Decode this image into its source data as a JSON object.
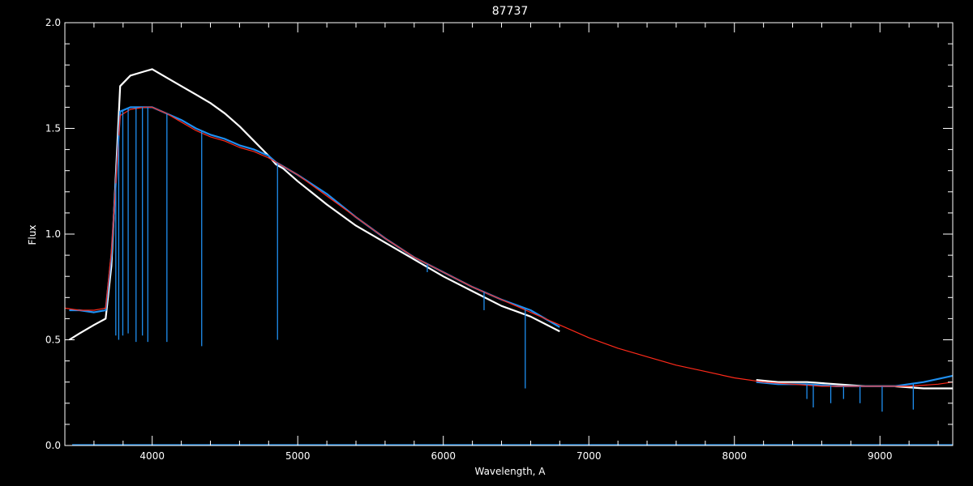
{
  "chart_data": {
    "type": "line",
    "title": "87737",
    "xlabel": "Wavelength, A",
    "ylabel": "Flux",
    "xlim": [
      3400,
      9500
    ],
    "ylim": [
      0.0,
      2.0
    ],
    "xticks": [
      4000,
      5000,
      6000,
      7000,
      8000,
      9000
    ],
    "yticks": [
      0.0,
      0.5,
      1.0,
      1.5,
      2.0
    ],
    "ytick_labels": [
      "0.0",
      "0.5",
      "1.0",
      "1.5",
      "2.0"
    ],
    "x_minor_step": 200,
    "y_minor_step": 0.1,
    "grid": false,
    "background": "#000000",
    "axis_color": "#ffffff",
    "series": [
      {
        "color": "#ffffff",
        "x": [
          3430,
          3500,
          3600,
          3680,
          3720,
          3780,
          3850,
          3950,
          4000,
          4100,
          4200,
          4300,
          4400,
          4500,
          4600,
          4700,
          4800,
          4850,
          4900,
          5000,
          5200,
          5400,
          5600,
          5800,
          6000,
          6200,
          6400,
          6600,
          6800,
          null,
          8150,
          8300,
          8500,
          8700,
          8900,
          9100,
          9300,
          9500
        ],
        "y": [
          0.5,
          0.53,
          0.57,
          0.6,
          0.85,
          1.7,
          1.75,
          1.77,
          1.78,
          1.74,
          1.7,
          1.66,
          1.62,
          1.57,
          1.51,
          1.44,
          1.37,
          1.33,
          1.31,
          1.25,
          1.14,
          1.04,
          0.96,
          0.88,
          0.8,
          0.73,
          0.66,
          0.61,
          0.54,
          null,
          0.31,
          0.3,
          0.3,
          0.29,
          0.28,
          0.28,
          0.27,
          0.27
        ]
      },
      {
        "color": "#1f8ff0",
        "x": [
          3430,
          3500,
          3600,
          3680,
          3720,
          3780,
          3850,
          3950,
          4000,
          4100,
          4200,
          4300,
          4400,
          4500,
          4600,
          4700,
          4800,
          4850,
          4900,
          5000,
          5200,
          5400,
          5600,
          5800,
          6000,
          6200,
          6400,
          6600,
          6800,
          null,
          8150,
          8300,
          8500,
          8700,
          8900,
          9100,
          9300,
          9500
        ],
        "y": [
          0.64,
          0.64,
          0.63,
          0.64,
          0.9,
          1.58,
          1.6,
          1.6,
          1.6,
          1.57,
          1.54,
          1.5,
          1.47,
          1.45,
          1.42,
          1.4,
          1.37,
          1.34,
          1.32,
          1.28,
          1.19,
          1.08,
          0.98,
          0.89,
          0.82,
          0.75,
          0.69,
          0.64,
          0.56,
          null,
          0.3,
          0.29,
          0.29,
          0.28,
          0.28,
          0.28,
          0.3,
          0.33
        ]
      },
      {
        "color": "#ff2a1a",
        "x": [
          3400,
          3500,
          3600,
          3680,
          3720,
          3780,
          3850,
          3950,
          4000,
          4100,
          4200,
          4300,
          4400,
          4500,
          4600,
          4700,
          4800,
          4900,
          5000,
          5200,
          5400,
          5600,
          5800,
          6000,
          6200,
          6400,
          6600,
          6800,
          7000,
          7200,
          7400,
          7600,
          7800,
          8000,
          8200,
          8400,
          8600,
          8800,
          9000,
          9200,
          9400,
          9500
        ],
        "y": [
          0.65,
          0.64,
          0.64,
          0.65,
          0.92,
          1.56,
          1.59,
          1.6,
          1.6,
          1.57,
          1.53,
          1.49,
          1.46,
          1.44,
          1.41,
          1.39,
          1.36,
          1.32,
          1.28,
          1.18,
          1.08,
          0.98,
          0.89,
          0.82,
          0.75,
          0.69,
          0.63,
          0.57,
          0.51,
          0.46,
          0.42,
          0.38,
          0.35,
          0.32,
          0.3,
          0.29,
          0.28,
          0.28,
          0.28,
          0.28,
          0.29,
          0.3
        ]
      }
    ],
    "absorption_lines": [
      {
        "x": 3750,
        "y": 0.52
      },
      {
        "x": 3770,
        "y": 0.5
      },
      {
        "x": 3798,
        "y": 0.52
      },
      {
        "x": 3835,
        "y": 0.53
      },
      {
        "x": 3889,
        "y": 0.49
      },
      {
        "x": 3933,
        "y": 0.52
      },
      {
        "x": 3970,
        "y": 0.49
      },
      {
        "x": 4101,
        "y": 0.49
      },
      {
        "x": 4340,
        "y": 0.47
      },
      {
        "x": 4861,
        "y": 0.5
      },
      {
        "x": 6563,
        "y": 0.27
      },
      {
        "x": 5890,
        "y": 0.82
      },
      {
        "x": 6280,
        "y": 0.64
      },
      {
        "x": 8498,
        "y": 0.22
      },
      {
        "x": 8542,
        "y": 0.18
      },
      {
        "x": 8662,
        "y": 0.2
      },
      {
        "x": 8750,
        "y": 0.22
      },
      {
        "x": 8863,
        "y": 0.2
      },
      {
        "x": 9015,
        "y": 0.16
      },
      {
        "x": 9229,
        "y": 0.17
      }
    ],
    "baseline": {
      "color": "#1f8ff0",
      "y": 0.0,
      "x": [
        3450,
        9500
      ]
    }
  }
}
